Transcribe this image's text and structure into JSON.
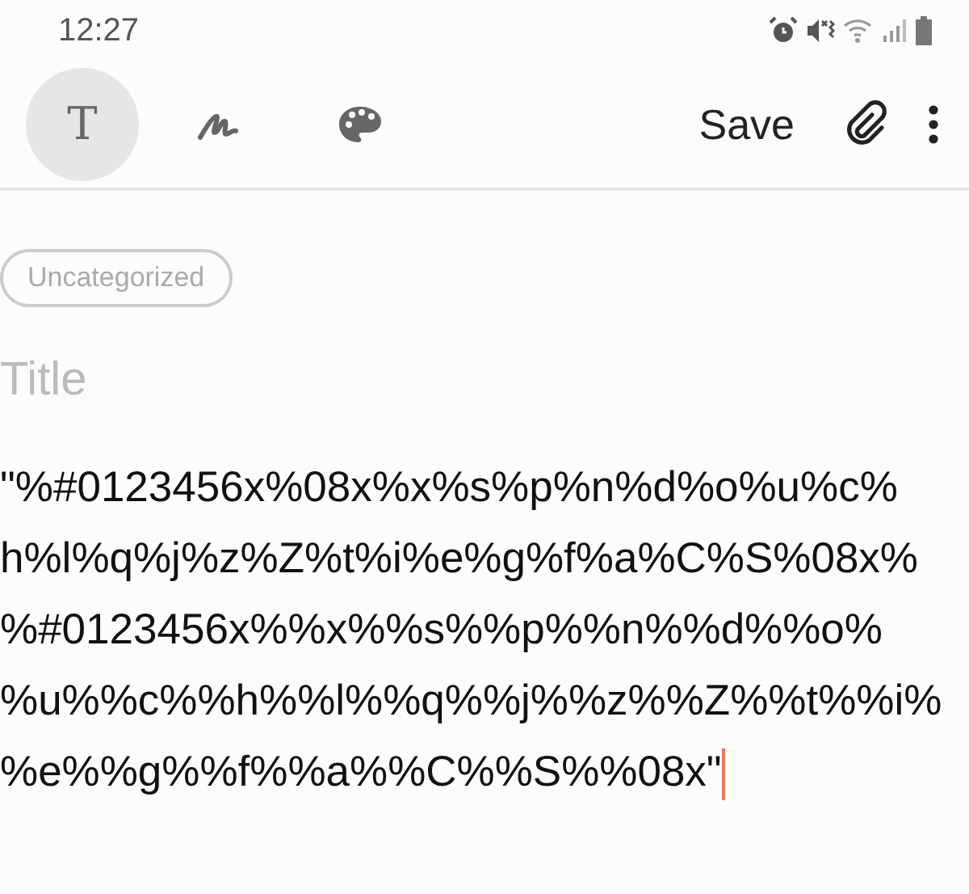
{
  "status_bar": {
    "time": "12:27"
  },
  "toolbar": {
    "tools": [
      {
        "kind": "text",
        "label": "T",
        "selected": true
      },
      {
        "kind": "handwriting",
        "selected": false
      },
      {
        "kind": "color",
        "selected": false
      }
    ],
    "save": "Save"
  },
  "note": {
    "category": "Uncategorized",
    "title_placeholder": "Title",
    "body_lines": [
      "\"%#0123456x%08x%x%s%p%n%d%o%u%c%",
      "h%l%q%j%z%Z%t%i%e%g%f%a%C%S%08x%",
      "%#0123456x%%x%%s%%p%%n%%d%%o%",
      "%u%%c%%h%%l%%q%%j%%z%%Z%%t%%i%",
      "%e%%g%%f%%a%%C%%S%%08x\""
    ],
    "editing": true
  }
}
